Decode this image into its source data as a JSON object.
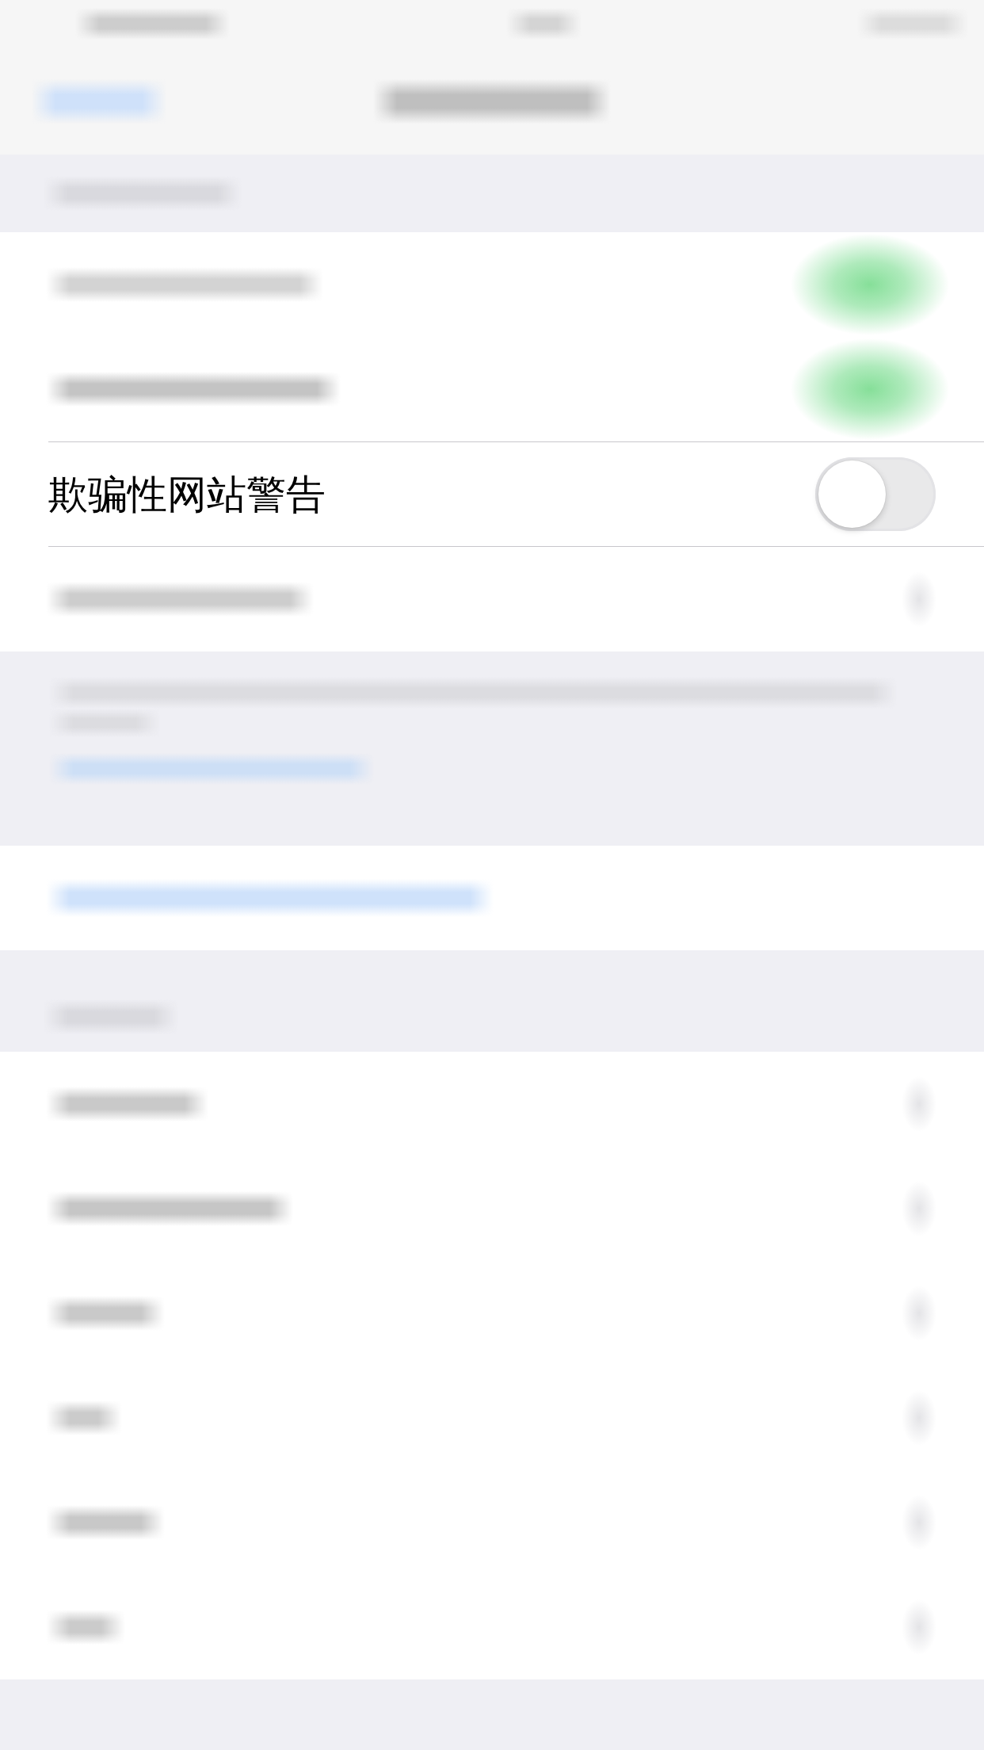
{
  "status_bar": {
    "blurred": true
  },
  "nav_bar": {
    "blurred": true
  },
  "groups": [
    {
      "header_blurred": true,
      "rows": [
        {
          "kind": "toggle",
          "blurred": true,
          "on": true
        },
        {
          "kind": "toggle",
          "blurred": true,
          "on": true
        },
        {
          "kind": "toggle",
          "label": "欺骗性网站警告",
          "on": false
        },
        {
          "kind": "disclosure",
          "blurred": true
        }
      ],
      "footer_blurred": true
    },
    {
      "rows": [
        {
          "kind": "link",
          "blurred": true
        }
      ]
    },
    {
      "header_blurred": true,
      "rows": [
        {
          "kind": "disclosure",
          "blurred": true
        },
        {
          "kind": "disclosure",
          "blurred": true
        },
        {
          "kind": "disclosure",
          "blurred": true
        },
        {
          "kind": "disclosure",
          "blurred": true
        },
        {
          "kind": "disclosure",
          "blurred": true
        },
        {
          "kind": "disclosure",
          "blurred": true
        }
      ]
    }
  ]
}
